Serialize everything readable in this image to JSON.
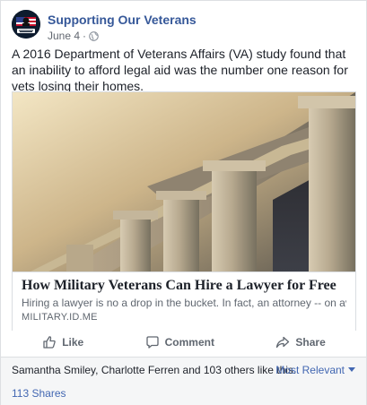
{
  "post": {
    "page_name": "Supporting Our Veterans",
    "avatar_text": "Support Our Veterans",
    "date": "June 4",
    "separator": "·",
    "privacy_icon": "globe-icon",
    "text": "A 2016 Department of Veterans Affairs (VA) study found that an inability to afford legal aid was the number one reason for vets losing their homes."
  },
  "link": {
    "title": "How Military Veterans Can Hire a Lawyer for Free",
    "description": "Hiring a lawyer is no a drop in the bucket. In fact, an attorney -- on average...",
    "domain": "MILITARY.ID.ME",
    "image_subject": "courthouse columns"
  },
  "actions": {
    "like": "Like",
    "comment": "Comment",
    "share": "Share"
  },
  "footer": {
    "likes_text": "Samantha Smiley, Charlotte Ferren and 103 others like this.",
    "sort_label": "Most Relevant",
    "shares_text": "113 Shares"
  },
  "colors": {
    "page_name": "#365899",
    "link_blue": "#4267b2",
    "text_dark": "#1d2129",
    "text_gray": "#606770"
  }
}
